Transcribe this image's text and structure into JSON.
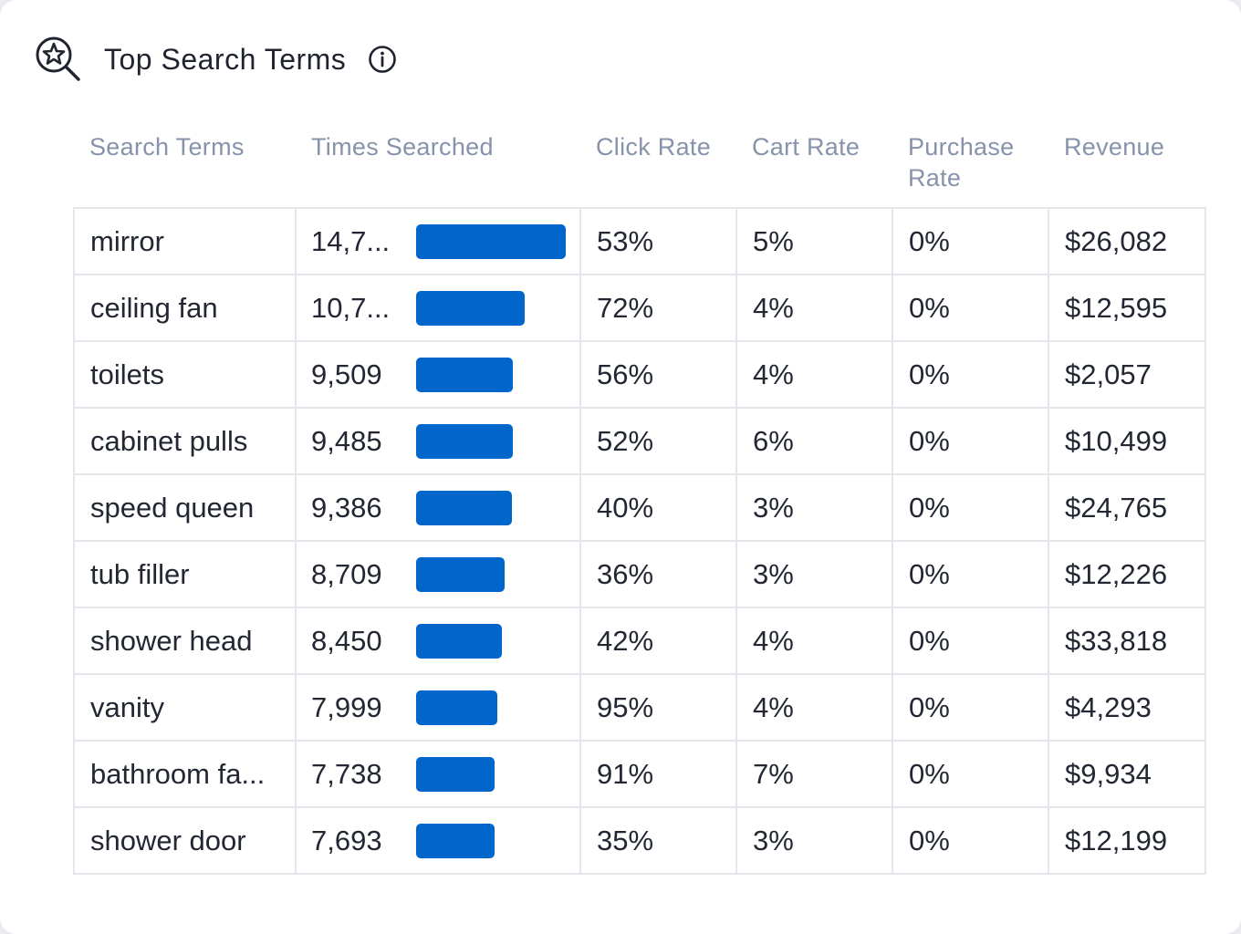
{
  "header": {
    "title": "Top Search Terms",
    "icon": "search-star-icon",
    "info_icon": "info-icon"
  },
  "columns": [
    "Search Terms",
    "Times Searched",
    "Click Rate",
    "Cart Rate",
    "Purchase Rate",
    "Revenue"
  ],
  "bar_color": "#0066cc",
  "rows": [
    {
      "term": "mirror",
      "times": "14,7...",
      "times_value": 14700,
      "click": "53%",
      "cart": "5%",
      "purchase": "0%",
      "revenue": "$26,082"
    },
    {
      "term": "ceiling fan",
      "times": "10,7...",
      "times_value": 10700,
      "click": "72%",
      "cart": "4%",
      "purchase": "0%",
      "revenue": "$12,595"
    },
    {
      "term": "toilets",
      "times": "9,509",
      "times_value": 9509,
      "click": "56%",
      "cart": "4%",
      "purchase": "0%",
      "revenue": "$2,057"
    },
    {
      "term": "cabinet pulls",
      "times": "9,485",
      "times_value": 9485,
      "click": "52%",
      "cart": "6%",
      "purchase": "0%",
      "revenue": "$10,499"
    },
    {
      "term": "speed queen",
      "times": "9,386",
      "times_value": 9386,
      "click": "40%",
      "cart": "3%",
      "purchase": "0%",
      "revenue": "$24,765"
    },
    {
      "term": "tub filler",
      "times": "8,709",
      "times_value": 8709,
      "click": "36%",
      "cart": "3%",
      "purchase": "0%",
      "revenue": "$12,226"
    },
    {
      "term": "shower head",
      "times": "8,450",
      "times_value": 8450,
      "click": "42%",
      "cart": "4%",
      "purchase": "0%",
      "revenue": "$33,818"
    },
    {
      "term": "vanity",
      "times": "7,999",
      "times_value": 7999,
      "click": "95%",
      "cart": "4%",
      "purchase": "0%",
      "revenue": "$4,293"
    },
    {
      "term": "bathroom fa...",
      "times": "7,738",
      "times_value": 7738,
      "click": "91%",
      "cart": "7%",
      "purchase": "0%",
      "revenue": "$9,934"
    },
    {
      "term": "shower door",
      "times": "7,693",
      "times_value": 7693,
      "click": "35%",
      "cart": "3%",
      "purchase": "0%",
      "revenue": "$12,199"
    }
  ]
}
